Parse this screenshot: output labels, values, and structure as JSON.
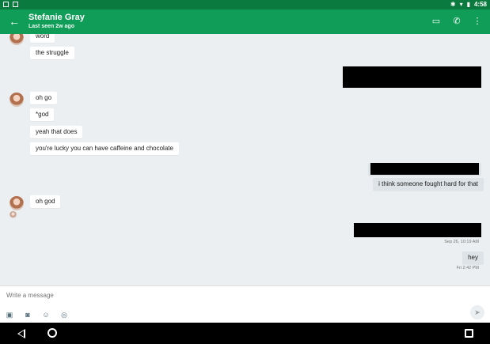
{
  "status_bar": {
    "time": "4:58"
  },
  "header": {
    "title": "Stefanie Gray",
    "subtitle": "Last seen 2w ago"
  },
  "messages": {
    "m1": "word",
    "m2": "the struggle",
    "m3": "oh go",
    "m4": "*god",
    "m5": "yeah that does",
    "m6": "you're lucky you can have caffeine and chocolate",
    "m7": "i think someone fought hard for that",
    "m8": "oh god",
    "m9": "hey"
  },
  "timestamps": {
    "t1": "Sep 26, 10:19 AM",
    "t2": "Fri 2:42 PM"
  },
  "composer": {
    "placeholder": "Write a message"
  },
  "colors": {
    "app_bar": "#0f9d58",
    "status_bar": "#0b7a3e",
    "chat_bg": "#eceff1",
    "outgoing_bubble": "#dde3e6"
  },
  "icons": {
    "back": "arrow-left-icon",
    "video": "video-call-icon",
    "phone": "phone-icon",
    "more": "more-vert-icon",
    "image": "image-icon",
    "camera": "camera-icon",
    "sticker": "sticker-icon",
    "location": "location-icon",
    "send": "send-icon"
  }
}
